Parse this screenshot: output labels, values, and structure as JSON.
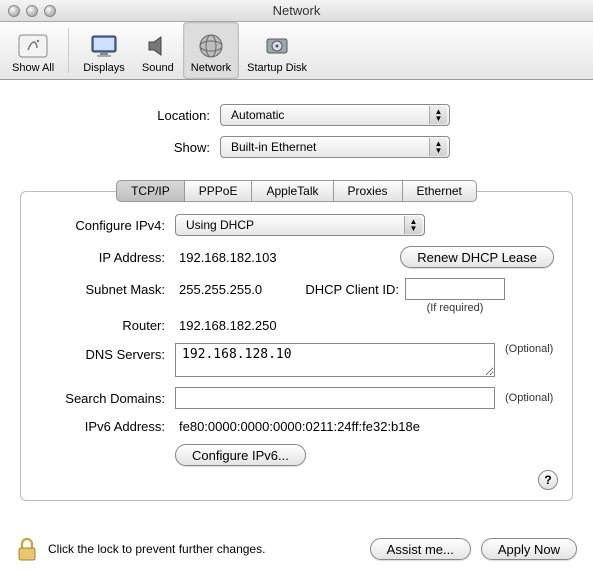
{
  "window": {
    "title": "Network"
  },
  "toolbar": {
    "items": [
      {
        "label": "Show All"
      },
      {
        "label": "Displays"
      },
      {
        "label": "Sound"
      },
      {
        "label": "Network"
      },
      {
        "label": "Startup Disk"
      }
    ]
  },
  "selectors": {
    "location_label": "Location:",
    "location_value": "Automatic",
    "show_label": "Show:",
    "show_value": "Built-in Ethernet"
  },
  "tabs": {
    "tcpip": "TCP/IP",
    "pppoe": "PPPoE",
    "appletalk": "AppleTalk",
    "proxies": "Proxies",
    "ethernet": "Ethernet"
  },
  "net": {
    "configure_label": "Configure IPv4:",
    "configure_value": "Using DHCP",
    "ip_label": "IP Address:",
    "ip_value": "192.168.182.103",
    "renew_label": "Renew DHCP Lease",
    "subnet_label": "Subnet Mask:",
    "subnet_value": "255.255.255.0",
    "clientid_label": "DHCP Client ID:",
    "clientid_value": "",
    "clientid_note": "(If required)",
    "router_label": "Router:",
    "router_value": "192.168.182.250",
    "dns_label": "DNS Servers:",
    "dns_value": "192.168.128.10",
    "dns_optional": "(Optional)",
    "search_label": "Search Domains:",
    "search_value": "",
    "search_optional": "(Optional)",
    "ipv6addr_label": "IPv6 Address:",
    "ipv6addr_value": "fe80:0000:0000:0000:0211:24ff:fe32:b18e",
    "configurev6_label": "Configure IPv6..."
  },
  "footer": {
    "lock_text": "Click the lock to prevent further changes.",
    "assist": "Assist me...",
    "apply": "Apply Now"
  },
  "help": "?"
}
